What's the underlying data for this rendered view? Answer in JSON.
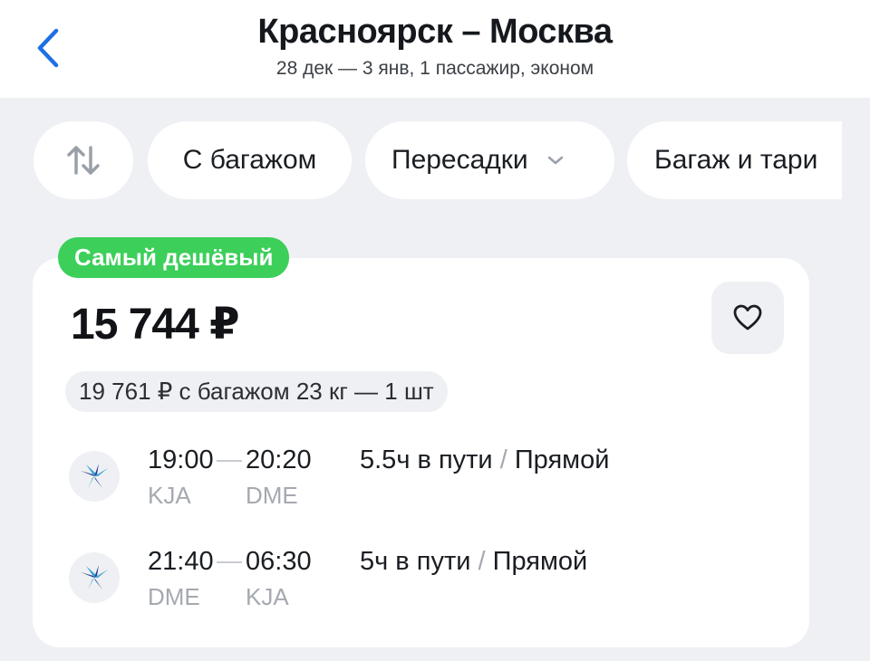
{
  "header": {
    "title": "Красноярск – Москва",
    "subtitle": "28 дек — 3 янв, 1 пассажир, эконом"
  },
  "filters": {
    "sort_icon": "sort-arrows-icon",
    "baggage_label": "С багажом",
    "transfers_label": "Пересадки",
    "tariffs_label": "Багаж и тари"
  },
  "offer": {
    "badge": "Самый дешёвый",
    "price": "15 744 ₽",
    "baggage_price": "19 761 ₽ с багажом 23 кг — 1 шт",
    "favorite_icon": "heart-icon",
    "accent_color": "#3ccf5a",
    "segments": [
      {
        "dep_time": "19:00",
        "arr_time": "20:20",
        "dep_code": "KJA",
        "arr_code": "DME",
        "duration": "5.5ч в пути",
        "sep": "/",
        "type": "Прямой"
      },
      {
        "dep_time": "21:40",
        "arr_time": "06:30",
        "dep_code": "DME",
        "arr_code": "KJA",
        "duration": "5ч в пути",
        "sep": "/",
        "type": "Прямой"
      }
    ]
  }
}
